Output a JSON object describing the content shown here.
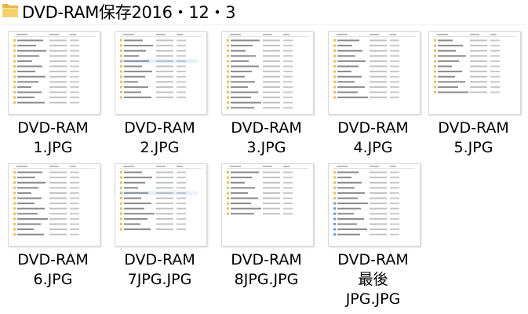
{
  "window": {
    "title": "DVD-RAM保存2016・12・3",
    "icon": "folder-icon"
  },
  "files": [
    {
      "lines": [
        "DVD-RAM",
        "1.JPG"
      ]
    },
    {
      "lines": [
        "DVD-RAM",
        "2.JPG"
      ]
    },
    {
      "lines": [
        "DVD-RAM",
        "3.JPG"
      ]
    },
    {
      "lines": [
        "DVD-RAM",
        "4.JPG"
      ]
    },
    {
      "lines": [
        "DVD-RAM",
        "5.JPG"
      ]
    },
    {
      "lines": [
        "DVD-RAM",
        "6.JPG"
      ]
    },
    {
      "lines": [
        "DVD-RAM",
        "7JPG.JPG"
      ]
    },
    {
      "lines": [
        "DVD-RAM",
        "8JPG.JPG"
      ]
    },
    {
      "lines": [
        "DVD-RAM",
        "最後",
        "JPG.JPG"
      ]
    }
  ]
}
